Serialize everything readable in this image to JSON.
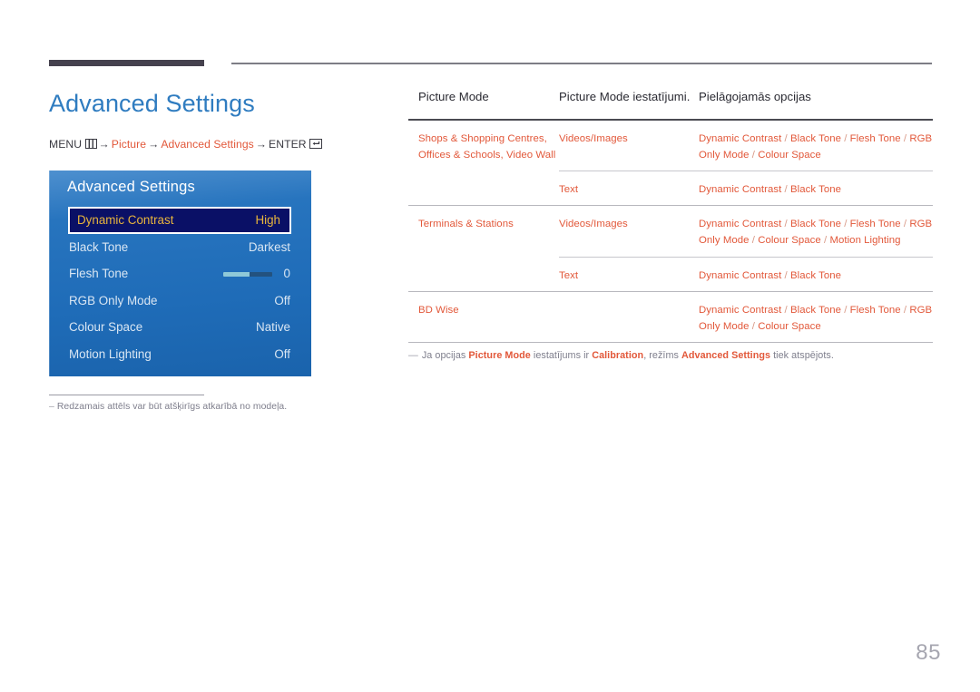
{
  "page": {
    "title": "Advanced Settings",
    "page_number": "85",
    "breadcrumb": {
      "menu_label": "MENU",
      "menu_icon": "menu-grid-icon",
      "arrow": "→",
      "step1": "Picture",
      "step2": "Advanced Settings",
      "enter_label": "ENTER",
      "enter_icon": "enter-key-icon"
    },
    "footnote": {
      "dash": "–",
      "text": "Redzamais attēls var būt atšķirīgs atkarībā no modeļa."
    }
  },
  "osd": {
    "title": "Advanced Settings",
    "rows": [
      {
        "label": "Dynamic Contrast",
        "value": "High",
        "selected": true,
        "slider": false
      },
      {
        "label": "Black Tone",
        "value": "Darkest",
        "selected": false,
        "slider": false
      },
      {
        "label": "Flesh Tone",
        "value": "0",
        "selected": false,
        "slider": true,
        "slider_fill_pct": 55
      },
      {
        "label": "RGB Only Mode",
        "value": "Off",
        "selected": false,
        "slider": false
      },
      {
        "label": "Colour Space",
        "value": "Native",
        "selected": false,
        "slider": false
      },
      {
        "label": "Motion Lighting",
        "value": "Off",
        "selected": false,
        "slider": false
      }
    ]
  },
  "table": {
    "headers": {
      "col1": "Picture Mode",
      "col2": "Picture Mode iestatījumi.",
      "col3": "Pielāgojamās opcijas"
    },
    "groups": [
      {
        "mode": "Shops & Shopping Centres, Offices & Schools, Video Wall",
        "rows": [
          {
            "setting": "Videos/Images",
            "options": "Dynamic Contrast / Black Tone / Flesh Tone / RGB Only Mode / Colour Space"
          },
          {
            "setting": "Text",
            "options": "Dynamic Contrast / Black Tone"
          }
        ]
      },
      {
        "mode": "Terminals & Stations",
        "rows": [
          {
            "setting": "Videos/Images",
            "options": "Dynamic Contrast / Black Tone / Flesh Tone / RGB Only Mode / Colour Space / Motion Lighting"
          },
          {
            "setting": "Text",
            "options": "Dynamic Contrast / Black Tone"
          }
        ]
      },
      {
        "mode": "BD Wise",
        "rows": [
          {
            "setting": "",
            "options": "Dynamic Contrast / Black Tone / Flesh Tone / RGB Only Mode / Colour Space"
          }
        ]
      }
    ],
    "footnote": {
      "dash": "—",
      "part1": "Ja opcijas ",
      "bold1": "Picture Mode",
      "part2": " iestatījums ir ",
      "bold2": "Calibration",
      "part3": ", režīms ",
      "bold3": "Advanced Settings",
      "part4": " tiek atspējots."
    }
  },
  "colors": {
    "title_blue": "#2f7cc0",
    "accent_orange": "#e2583a",
    "osd_blue": "#2774be",
    "osd_selected_bg": "#0a1066",
    "osd_selected_text": "#e8b53c",
    "rule_dark": "#45414e",
    "muted_text": "#7e7e8c"
  }
}
